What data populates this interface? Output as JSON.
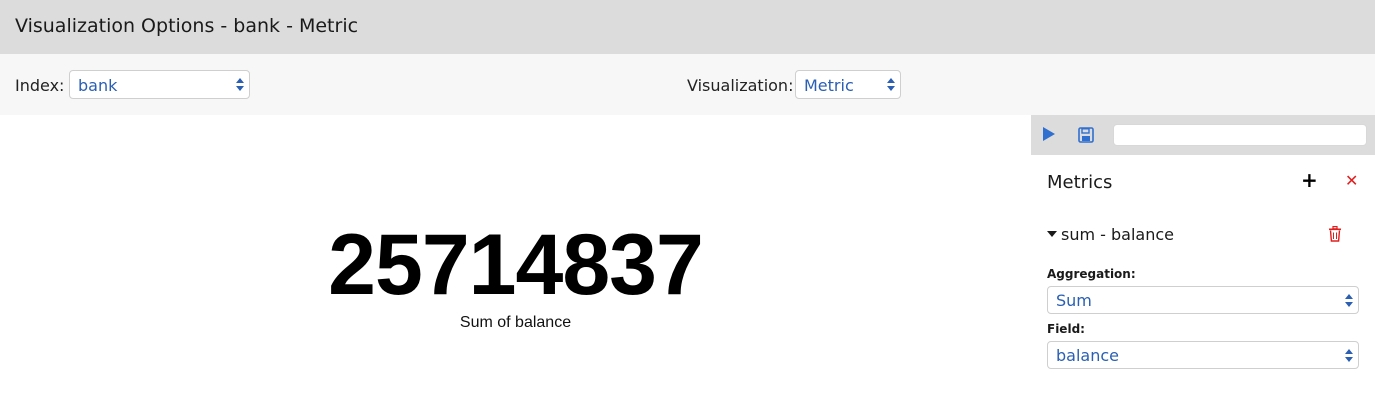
{
  "header": {
    "title": "Visualization Options - bank - Metric"
  },
  "options": {
    "index_label": "Index:",
    "index_value": "bank",
    "visualization_label": "Visualization:",
    "visualization_value": "Metric"
  },
  "metric": {
    "value": "25714837",
    "label": "Sum of balance"
  },
  "sidebar": {
    "toolbar": {
      "play_icon": "play-icon",
      "save_icon": "floppy-disk-icon",
      "search_value": ""
    },
    "heading": "Metrics",
    "add_icon": "plus-icon",
    "close_icon": "x-icon",
    "aggregation_item": {
      "title": "sum - balance",
      "delete_icon": "trash-icon",
      "aggregation_label": "Aggregation:",
      "aggregation_value": "Sum",
      "field_label": "Field:",
      "field_value": "balance"
    }
  },
  "colors": {
    "accent": "#2a5fb3",
    "danger": "#e01e1e",
    "header_bg": "#dcdcdc",
    "options_bg": "#f7f7f7"
  }
}
